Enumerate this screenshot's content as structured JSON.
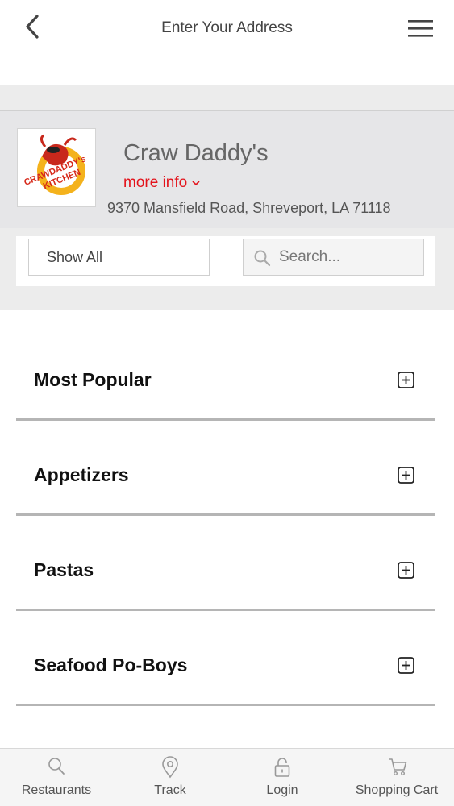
{
  "header": {
    "title": "Enter Your Address"
  },
  "restaurant": {
    "name": "Craw Daddy's",
    "more_info": "more info",
    "address": "9370 Mansfield Road, Shreveport, LA 71118",
    "logo_text_line1": "CRAWDADDY's",
    "logo_text_line2": "KITCHEN"
  },
  "filters": {
    "show_all": "Show All",
    "search_placeholder": "Search..."
  },
  "categories": [
    {
      "label": "Most Popular"
    },
    {
      "label": "Appetizers"
    },
    {
      "label": "Pastas"
    },
    {
      "label": "Seafood Po-Boys"
    }
  ],
  "tabbar": {
    "items": [
      {
        "label": "Restaurants",
        "icon": "search-icon"
      },
      {
        "label": "Track",
        "icon": "map-pin-icon"
      },
      {
        "label": "Login",
        "icon": "lock-icon"
      },
      {
        "label": "Shopping Cart",
        "icon": "cart-icon"
      }
    ]
  },
  "colors": {
    "accent_red": "#e3131b",
    "band_gray": "#ececec",
    "divider_gray": "#b5b5b5"
  }
}
